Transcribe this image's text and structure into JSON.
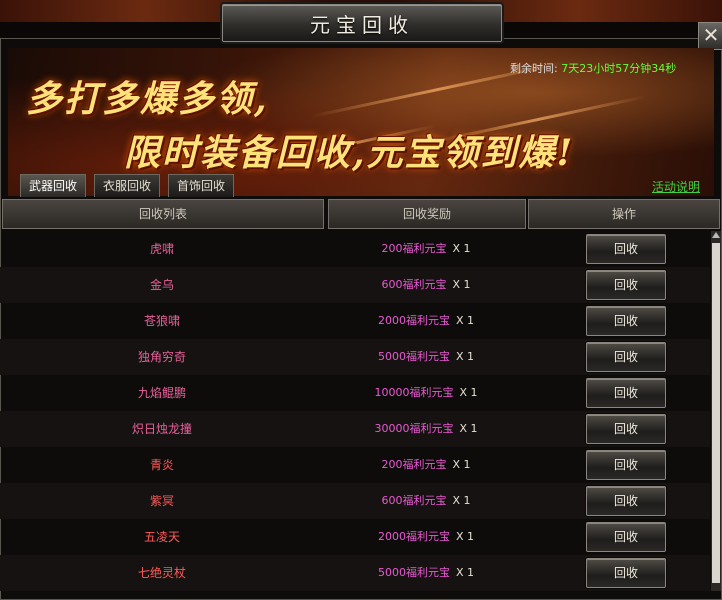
{
  "window": {
    "title": "元宝回收",
    "close_label": "✕"
  },
  "banner": {
    "timer_label": "剩余时间:",
    "timer_value": "7天23小时57分钟34秒",
    "slogan_line1": "多打多爆多领,",
    "slogan_line2": "限时装备回收,元宝领到爆!"
  },
  "tabs": [
    {
      "label": "武器回收",
      "active": true
    },
    {
      "label": "衣服回收",
      "active": false
    },
    {
      "label": "首饰回收",
      "active": false
    }
  ],
  "help_link": "活动说明",
  "table": {
    "headers": [
      "回收列表",
      "回收奖励",
      "操作"
    ],
    "button_label": "回收",
    "rows": [
      {
        "name": "虎啸",
        "name_color": "#e8609a",
        "reward": "200福利元宝",
        "qty": "X 1"
      },
      {
        "name": "金乌",
        "name_color": "#e8609a",
        "reward": "600福利元宝",
        "qty": "X 1"
      },
      {
        "name": "苍狼啸",
        "name_color": "#e8609a",
        "reward": "2000福利元宝",
        "qty": "X 1"
      },
      {
        "name": "独角穷奇",
        "name_color": "#e8609a",
        "reward": "5000福利元宝",
        "qty": "X 1"
      },
      {
        "name": "九焰鲲鹏",
        "name_color": "#e8609a",
        "reward": "10000福利元宝",
        "qty": "X 1"
      },
      {
        "name": "炽日烛龙撞",
        "name_color": "#e8609a",
        "reward": "30000福利元宝",
        "qty": "X 1"
      },
      {
        "name": "青炎",
        "name_color": "#ff5a5a",
        "reward": "200福利元宝",
        "qty": "X 1"
      },
      {
        "name": "紫冥",
        "name_color": "#ff5a5a",
        "reward": "600福利元宝",
        "qty": "X 1"
      },
      {
        "name": "五凌天",
        "name_color": "#ff5a5a",
        "reward": "2000福利元宝",
        "qty": "X 1"
      },
      {
        "name": "七绝灵杖",
        "name_color": "#ff5a5a",
        "reward": "5000福利元宝",
        "qty": "X 1"
      }
    ]
  }
}
